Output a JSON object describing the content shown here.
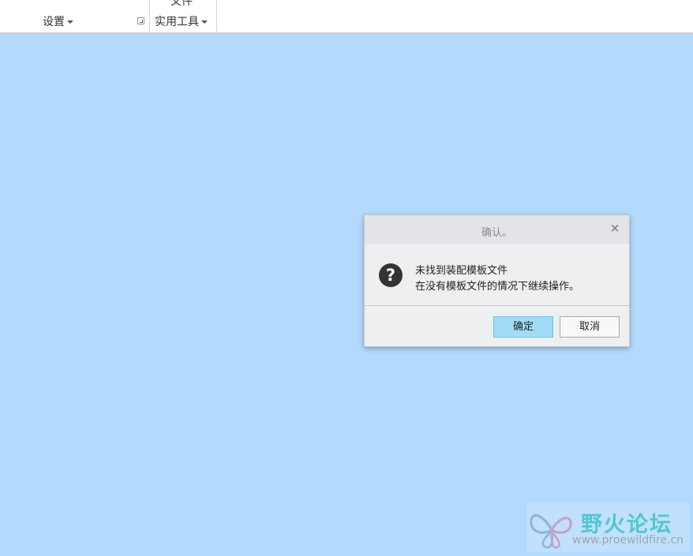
{
  "ribbon": {
    "groups": [
      {
        "label": "设置"
      },
      {
        "label": "实用工具"
      }
    ],
    "cut_text": "文件"
  },
  "dialog": {
    "title": "确认。",
    "close_glyph": "×",
    "icon_glyph": "?",
    "message_lines": [
      "未找到装配模板文件",
      "在没有模板文件的情况下继续操作。"
    ],
    "buttons": {
      "ok": "确定",
      "cancel": "取消"
    }
  },
  "watermark": {
    "title": "野火论坛",
    "url": "www.proewildfire.cn"
  },
  "colors": {
    "canvas": "#b3d9fd",
    "ok_button": "#a1dcf6",
    "watermark_title": "#54c6cf"
  }
}
